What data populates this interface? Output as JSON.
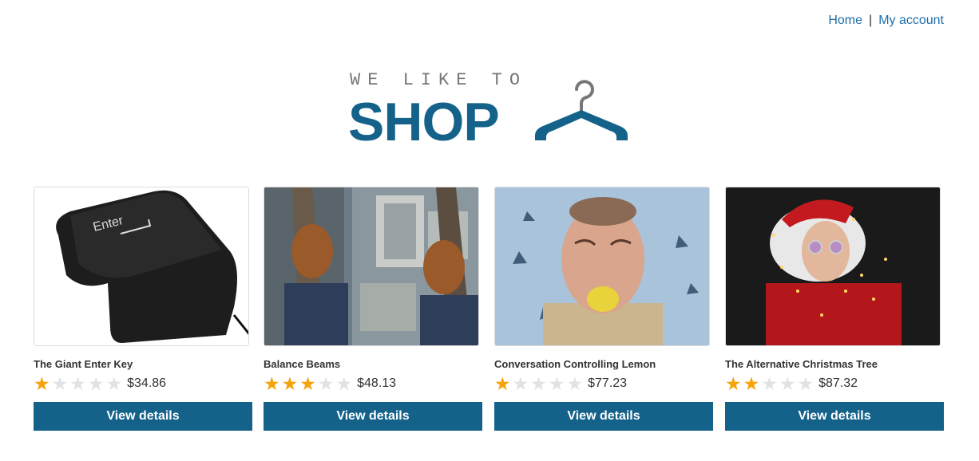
{
  "nav": {
    "home": "Home",
    "separator": "|",
    "account": "My account"
  },
  "logo": {
    "tagline": "WE LIKE TO",
    "word": "SHOP",
    "icon": "hanger-icon"
  },
  "products": [
    {
      "name": "The Giant Enter Key",
      "rating": 1,
      "max_rating": 5,
      "price": "$34.86",
      "button": "View details",
      "image": "giant-enter-key-image",
      "image_text": "Enter"
    },
    {
      "name": "Balance Beams",
      "rating": 3,
      "max_rating": 5,
      "price": "$48.13",
      "button": "View details",
      "image": "balance-beams-image"
    },
    {
      "name": "Conversation Controlling Lemon",
      "rating": 1,
      "max_rating": 5,
      "price": "$77.23",
      "button": "View details",
      "image": "lemon-image"
    },
    {
      "name": "The Alternative Christmas Tree",
      "rating": 2,
      "max_rating": 5,
      "price": "$87.32",
      "button": "View details",
      "image": "christmas-tree-image"
    }
  ],
  "colors": {
    "accent": "#14628a",
    "link": "#1f6fa8",
    "star_on": "#f5a20b",
    "star_off": "#dfe3e6"
  }
}
